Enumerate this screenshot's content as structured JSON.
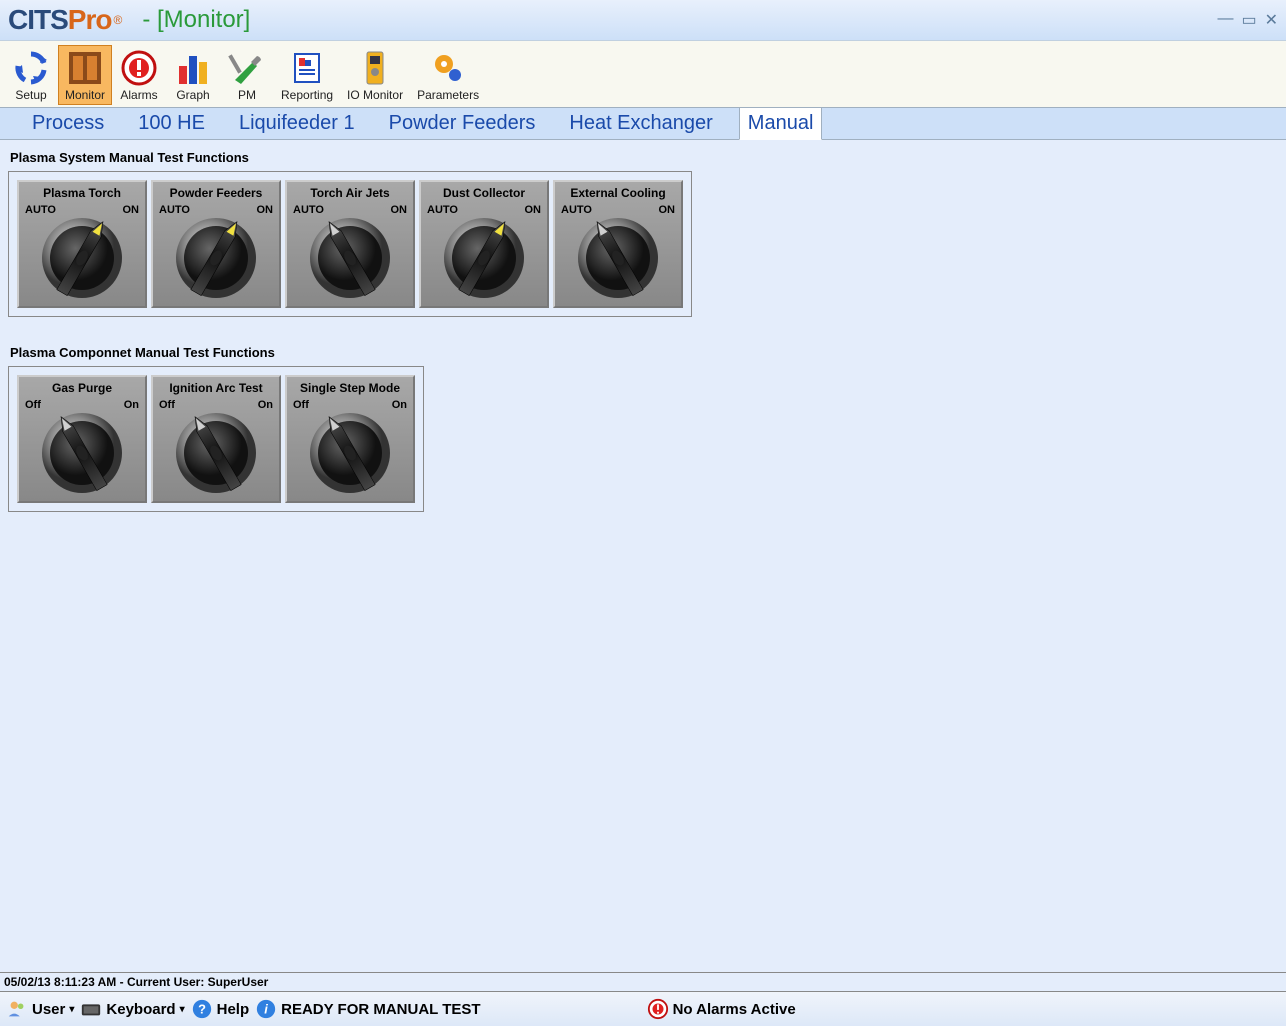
{
  "titlebar": {
    "subtitle": "- [Monitor]"
  },
  "toolbar": {
    "items": [
      {
        "label": "Setup"
      },
      {
        "label": "Monitor"
      },
      {
        "label": "Alarms"
      },
      {
        "label": "Graph"
      },
      {
        "label": "PM"
      },
      {
        "label": "Reporting"
      },
      {
        "label": "IO Monitor"
      },
      {
        "label": "Parameters"
      }
    ]
  },
  "tabs": {
    "items": [
      {
        "label": "Process"
      },
      {
        "label": "100 HE"
      },
      {
        "label": "Liquifeeder 1"
      },
      {
        "label": "Powder Feeders"
      },
      {
        "label": "Heat Exchanger"
      },
      {
        "label": "Manual"
      }
    ]
  },
  "section1": {
    "title": "Plasma System Manual Test Functions",
    "left_label": "AUTO",
    "right_label": "ON",
    "switches": [
      {
        "name": "Plasma Torch",
        "on": true
      },
      {
        "name": "Powder Feeders",
        "on": true
      },
      {
        "name": "Torch Air Jets",
        "on": false
      },
      {
        "name": "Dust Collector",
        "on": true
      },
      {
        "name": "External Cooling",
        "on": false
      }
    ]
  },
  "section2": {
    "title": "Plasma Componnet Manual Test Functions",
    "left_label": "Off",
    "right_label": "On",
    "switches": [
      {
        "name": "Gas Purge",
        "on": false
      },
      {
        "name": "Ignition Arc Test",
        "on": false
      },
      {
        "name": "Single Step Mode",
        "on": false
      }
    ]
  },
  "statusline": {
    "text": "05/02/13 8:11:23 AM - Current User:  SuperUser"
  },
  "bottombar": {
    "user": "User",
    "keyboard": "Keyboard",
    "help": "Help",
    "status": "READY FOR MANUAL TEST",
    "alarms": "No Alarms Active"
  }
}
